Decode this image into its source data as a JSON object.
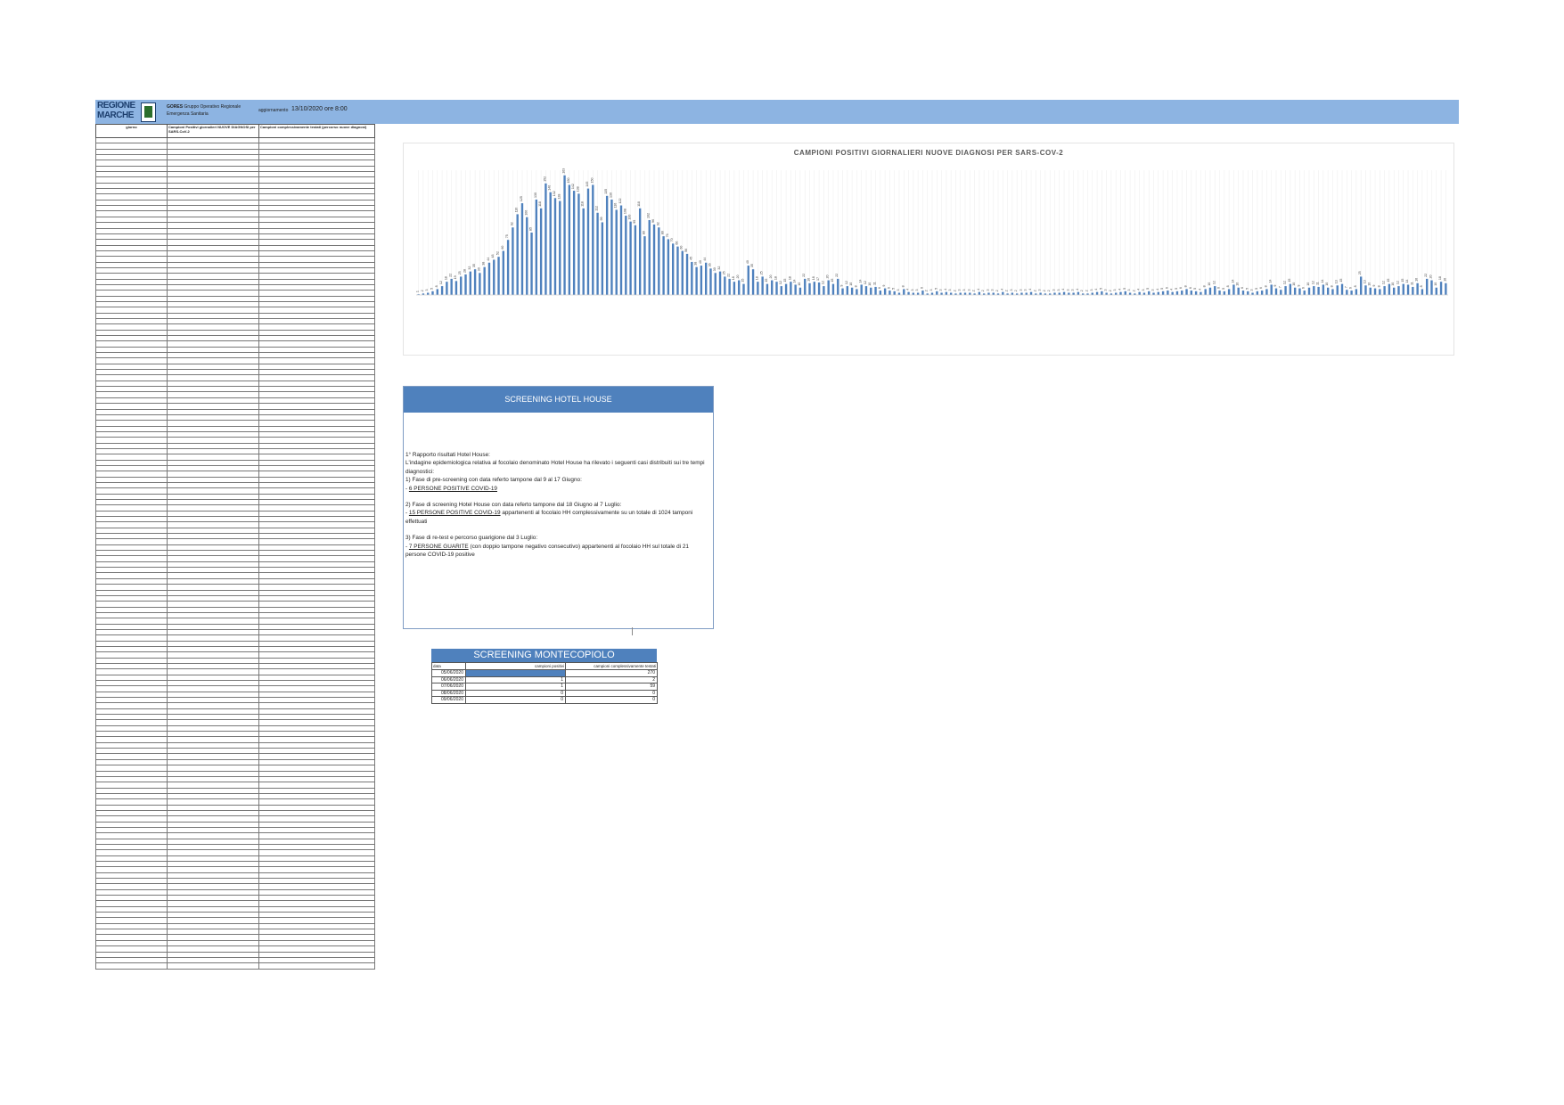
{
  "header": {
    "logo_text": "REGIONE MARCHE",
    "gores_bold": "GORES",
    "gores_text": "Gruppo Operativo Regionale Emergenza Sanitaria",
    "agg_label": "aggiornamento",
    "agg_value": "13/10/2020 ore 8:00"
  },
  "left_table": {
    "columns": [
      "giorno",
      "Campioni Positivi giornalieri NUOVE DIAGNOSI per SARS-CoV-2",
      "Campioni complessivamente testati (percorso nuove diagnosi)"
    ],
    "rows": [
      [
        "",
        "",
        ""
      ],
      [
        "",
        "",
        ""
      ],
      [
        "",
        "",
        ""
      ],
      [
        "",
        "",
        ""
      ],
      [
        "",
        "",
        ""
      ],
      [
        "",
        "",
        ""
      ],
      [
        "",
        "",
        ""
      ],
      [
        "",
        "",
        ""
      ],
      [
        "",
        "",
        ""
      ],
      [
        "",
        "",
        ""
      ],
      [
        "",
        "",
        ""
      ],
      [
        "",
        "",
        ""
      ],
      [
        "",
        "",
        ""
      ],
      [
        "",
        "",
        ""
      ],
      [
        "",
        "",
        ""
      ],
      [
        "",
        "",
        ""
      ],
      [
        "",
        "",
        ""
      ],
      [
        "",
        "",
        ""
      ],
      [
        "",
        "",
        ""
      ],
      [
        "",
        "",
        ""
      ],
      [
        "",
        "",
        ""
      ],
      [
        "",
        "",
        ""
      ],
      [
        "",
        "",
        ""
      ],
      [
        "",
        "",
        ""
      ],
      [
        "",
        "",
        ""
      ],
      [
        "",
        "",
        ""
      ],
      [
        "",
        "",
        ""
      ],
      [
        "",
        "",
        ""
      ],
      [
        "",
        "",
        ""
      ],
      [
        "",
        "",
        ""
      ],
      [
        "",
        "",
        ""
      ],
      [
        "",
        "",
        ""
      ],
      [
        "",
        "",
        ""
      ],
      [
        "",
        "",
        ""
      ],
      [
        "",
        "",
        ""
      ],
      [
        "",
        "",
        ""
      ],
      [
        "",
        "",
        ""
      ],
      [
        "",
        "",
        ""
      ],
      [
        "",
        "",
        ""
      ],
      [
        "",
        "",
        ""
      ],
      [
        "",
        "",
        ""
      ],
      [
        "",
        "",
        ""
      ],
      [
        "",
        "",
        ""
      ],
      [
        "",
        "",
        ""
      ],
      [
        "",
        "",
        ""
      ],
      [
        "",
        "",
        ""
      ],
      [
        "",
        "",
        ""
      ],
      [
        "",
        "",
        ""
      ],
      [
        "",
        "",
        ""
      ],
      [
        "",
        "",
        ""
      ],
      [
        "",
        "",
        ""
      ],
      [
        "",
        "",
        ""
      ],
      [
        "",
        "",
        ""
      ],
      [
        "",
        "",
        ""
      ],
      [
        "",
        "",
        ""
      ],
      [
        "",
        "",
        ""
      ],
      [
        "",
        "",
        ""
      ],
      [
        "",
        "",
        ""
      ],
      [
        "",
        "",
        ""
      ],
      [
        "",
        "",
        ""
      ],
      [
        "",
        "",
        ""
      ],
      [
        "",
        "",
        ""
      ],
      [
        "",
        "",
        ""
      ],
      [
        "",
        "",
        ""
      ],
      [
        "",
        "",
        ""
      ],
      [
        "",
        "",
        ""
      ],
      [
        "",
        "",
        ""
      ],
      [
        "",
        "",
        ""
      ],
      [
        "",
        "",
        ""
      ],
      [
        "",
        "",
        ""
      ],
      [
        "",
        "",
        ""
      ],
      [
        "",
        "",
        ""
      ],
      [
        "",
        "",
        ""
      ],
      [
        "",
        "",
        ""
      ],
      [
        "",
        "",
        ""
      ],
      [
        "",
        "",
        ""
      ],
      [
        "",
        "",
        ""
      ],
      [
        "",
        "",
        ""
      ],
      [
        "",
        "",
        ""
      ],
      [
        "",
        "",
        ""
      ],
      [
        "",
        "",
        ""
      ],
      [
        "",
        "",
        ""
      ],
      [
        "",
        "",
        ""
      ],
      [
        "",
        "",
        ""
      ],
      [
        "",
        "",
        ""
      ],
      [
        "",
        "",
        ""
      ],
      [
        "",
        "",
        ""
      ],
      [
        "",
        "",
        ""
      ],
      [
        "",
        "",
        ""
      ],
      [
        "",
        "",
        ""
      ],
      [
        "",
        "",
        ""
      ],
      [
        "",
        "",
        ""
      ],
      [
        "",
        "",
        ""
      ],
      [
        "",
        "",
        ""
      ],
      [
        "",
        "",
        ""
      ],
      [
        "",
        "",
        ""
      ],
      [
        "",
        "",
        ""
      ],
      [
        "",
        "",
        ""
      ],
      [
        "",
        "",
        ""
      ],
      [
        "",
        "",
        ""
      ],
      [
        "",
        "",
        ""
      ],
      [
        "",
        "",
        ""
      ],
      [
        "",
        "",
        ""
      ],
      [
        "",
        "",
        ""
      ],
      [
        "",
        "",
        ""
      ],
      [
        "",
        "",
        ""
      ],
      [
        "",
        "",
        ""
      ],
      [
        "",
        "",
        ""
      ],
      [
        "",
        "",
        ""
      ],
      [
        "",
        "",
        ""
      ],
      [
        "",
        "",
        ""
      ],
      [
        "",
        "",
        ""
      ],
      [
        "",
        "",
        ""
      ],
      [
        "",
        "",
        ""
      ],
      [
        "",
        "",
        ""
      ],
      [
        "",
        "",
        ""
      ],
      [
        "",
        "",
        ""
      ],
      [
        "",
        "",
        ""
      ],
      [
        "",
        "",
        ""
      ],
      [
        "",
        "",
        ""
      ],
      [
        "",
        "",
        ""
      ],
      [
        "",
        "",
        ""
      ],
      [
        "",
        "",
        ""
      ],
      [
        "",
        "",
        ""
      ],
      [
        "",
        "",
        ""
      ],
      [
        "",
        "",
        ""
      ],
      [
        "",
        "",
        ""
      ],
      [
        "",
        "",
        ""
      ],
      [
        "",
        "",
        ""
      ],
      [
        "",
        "",
        ""
      ],
      [
        "",
        "",
        ""
      ],
      [
        "",
        "",
        ""
      ],
      [
        "",
        "",
        ""
      ],
      [
        "",
        "",
        ""
      ],
      [
        "",
        "",
        ""
      ],
      [
        "",
        "",
        ""
      ],
      [
        "",
        "",
        ""
      ],
      [
        "",
        "",
        ""
      ],
      [
        "",
        "",
        ""
      ],
      [
        "",
        "",
        ""
      ],
      [
        "",
        "",
        ""
      ],
      [
        "",
        "",
        ""
      ],
      [
        "",
        "",
        ""
      ],
      [
        "",
        "",
        ""
      ],
      [
        "",
        "",
        ""
      ],
      [
        "",
        "",
        ""
      ],
      [
        "",
        "",
        ""
      ]
    ]
  },
  "chart_data": {
    "type": "bar",
    "title": "CAMPIONI POSITIVI GIORNALIERI NUOVE DIAGNOSI PER SARS-COV-2",
    "categories": [
      "",
      "",
      "",
      "",
      "",
      "",
      "",
      "",
      "",
      "",
      "",
      "",
      "",
      "",
      "",
      "",
      "",
      "",
      "",
      "",
      "",
      "",
      "",
      "",
      "",
      "",
      "",
      "",
      "",
      "",
      "",
      "",
      "",
      "",
      "",
      "",
      "",
      "",
      "",
      "",
      "",
      "",
      "",
      "",
      "",
      "",
      "",
      "",
      "",
      "",
      "",
      "",
      "",
      "",
      "",
      "",
      "",
      "",
      "",
      "",
      "",
      "",
      "",
      "",
      "",
      "",
      "",
      "",
      "",
      "",
      "",
      "",
      "",
      "",
      "",
      "",
      "",
      "",
      "",
      "",
      "",
      "",
      "",
      "",
      "",
      "",
      "",
      "",
      "",
      "",
      "",
      "",
      "",
      "",
      "",
      "",
      "",
      "",
      "",
      "",
      "",
      "",
      "",
      "",
      "",
      "",
      "",
      "",
      "",
      "",
      "",
      "",
      "",
      "",
      "",
      "",
      "",
      "",
      "",
      "",
      "",
      "",
      "",
      "",
      "",
      "",
      "",
      "",
      "",
      "",
      "",
      "",
      "",
      "",
      "",
      "",
      "",
      "",
      "",
      "",
      "",
      "",
      "",
      "",
      "",
      "",
      "",
      "",
      "",
      "",
      "",
      "",
      "",
      "",
      "",
      "",
      "",
      "",
      "",
      "",
      "",
      "",
      "",
      "",
      "",
      "",
      "",
      "",
      "",
      "",
      "",
      "",
      "",
      "",
      "",
      "",
      "",
      "",
      "",
      "",
      "",
      "",
      "",
      "",
      "",
      "",
      "",
      "",
      "",
      "",
      "",
      "",
      "",
      "",
      "",
      "",
      "",
      "",
      "",
      "",
      "",
      "",
      "",
      "",
      "",
      "",
      "",
      "",
      "",
      "",
      "",
      "",
      "",
      "",
      "",
      "",
      "",
      "",
      "",
      "",
      "",
      "",
      "",
      "",
      "",
      "",
      "",
      "",
      "",
      "",
      "",
      "",
      "",
      "",
      "",
      "",
      "",
      "",
      "",
      "",
      "",
      "",
      "",
      "",
      "",
      "",
      "",
      "",
      "",
      "",
      ""
    ],
    "series": [
      {
        "values": [
          1,
          2,
          3,
          5,
          8,
          12,
          18,
          22,
          19,
          25,
          28,
          32,
          35,
          30,
          38,
          44,
          48,
          52,
          60,
          75,
          92,
          110,
          125,
          106,
          85,
          130,
          118,
          152,
          140,
          132,
          128,
          163,
          150,
          142,
          138,
          118,
          145,
          150,
          112,
          99,
          135,
          130,
          116,
          122,
          108,
          100,
          95,
          118,
          80,
          102,
          96,
          92,
          80,
          76,
          70,
          66,
          60,
          56,
          45,
          38,
          40,
          44,
          36,
          30,
          32,
          25,
          22,
          18,
          20,
          15,
          40,
          35,
          18,
          25,
          15,
          20,
          18,
          12,
          15,
          18,
          14,
          10,
          22,
          16,
          18,
          17,
          12,
          20,
          15,
          22,
          9,
          12,
          10,
          8,
          14,
          12,
          10,
          11,
          6,
          9,
          6,
          5,
          3,
          8,
          4,
          3,
          3,
          6,
          2,
          3,
          5,
          3,
          4,
          3,
          2,
          3,
          3,
          3,
          2,
          4,
          2,
          3,
          3,
          2,
          4,
          2,
          3,
          2,
          3,
          3,
          4,
          2,
          3,
          2,
          2,
          3,
          3,
          4,
          3,
          3,
          4,
          2,
          2,
          3,
          4,
          5,
          3,
          2,
          3,
          4,
          5,
          3,
          2,
          4,
          3,
          5,
          3,
          4,
          5,
          6,
          4,
          5,
          6,
          8,
          6,
          5,
          4,
          8,
          10,
          12,
          6,
          5,
          8,
          14,
          10,
          6,
          5,
          3,
          5,
          6,
          8,
          14,
          9,
          7,
          12,
          15,
          10,
          9,
          6,
          10,
          12,
          11,
          14,
          10,
          8,
          13,
          15,
          7,
          6,
          8,
          25,
          13,
          10,
          9,
          8,
          12,
          15,
          10,
          12,
          15,
          14,
          11,
          16,
          8,
          22,
          20,
          10,
          18,
          16
        ]
      }
    ],
    "color": "#4f81bd"
  },
  "hotel_house": {
    "title": "SCREENING HOTEL HOUSE",
    "p1": "1° Rapporto risultati Hotel House:",
    "p2": "L'indagine epidemiologica relativa al focolaio denominato Hotel House ha rilevato i seguenti casi distribuiti sui tre tempi diagnostici:",
    "p3": "1) Fase di pre-screening con data referto tampone dal 9 al 17 Giugno:",
    "p4_dash": "- ",
    "p4_u": "6 PERSONE POSITIVE COVID-19",
    "p5": "2) Fase di screening Hotel House con data referto tampone dal 18 Giugno al 7 Luglio:",
    "p6_dash": "- ",
    "p6_u": "15 PERSONE POSITIVE COVID-19",
    "p6_rest": " appartenenti al focolaio HH complessivamente su un totale di 1024 tamponi effettuati",
    "p7": "3) Fase di re-test e percorso guarigione dal 3 Luglio:",
    "p8_dash": "- ",
    "p8_u": "7 PERSONE GUARITE",
    "p8_rest": " (con doppio tampone negativo consecutivo) appartenenti al focolaio HH sul totale di 21 persone COVID-19 positive"
  },
  "montecopiolo": {
    "title": "SCREENING MONTECOPIOLO",
    "columns": [
      "data",
      "campioni positivi",
      "campioni complessivamente testati"
    ],
    "rows": [
      [
        "05/06/2020",
        "",
        "270"
      ],
      [
        "06/06/2020",
        "1",
        "2"
      ],
      [
        "07/06/2020",
        "1",
        "59"
      ],
      [
        "08/06/2020",
        "0",
        "0"
      ],
      [
        "09/06/2020",
        "0",
        "0"
      ]
    ]
  }
}
